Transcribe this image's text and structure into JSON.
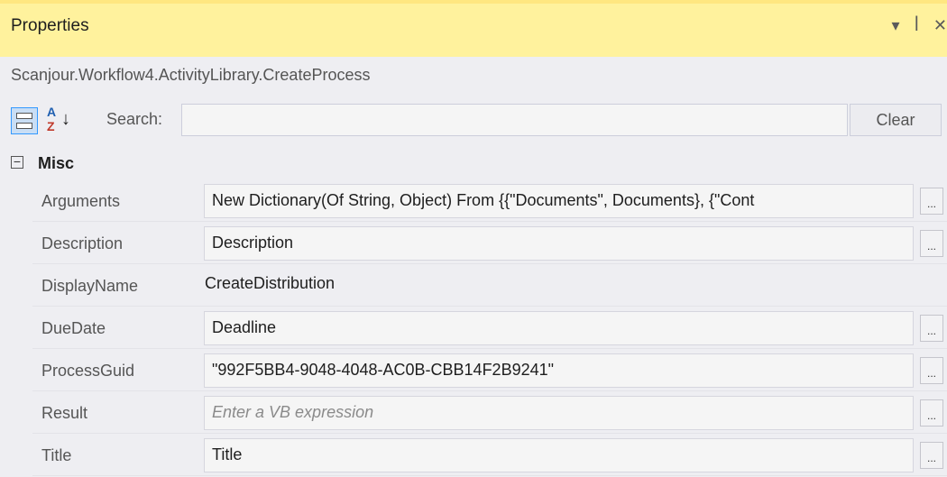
{
  "panel": {
    "title": "Properties",
    "dropdown_icon": "▾",
    "pin_icon": "ꟾ",
    "close_icon": "✕",
    "object_name": "Scanjour.Workflow4.ActivityLibrary.CreateProcess"
  },
  "toolbar": {
    "search_label": "Search:",
    "search_value": "",
    "clear_label": "Clear"
  },
  "category": {
    "toggle": "−",
    "label": "Misc"
  },
  "properties": [
    {
      "name": "Arguments",
      "value": "New Dictionary(Of String, Object) From {{\"Documents\", Documents}, {\"Cont",
      "kind": "box",
      "has_ellipsis": true
    },
    {
      "name": "Description",
      "value": "Description",
      "kind": "box",
      "has_ellipsis": true
    },
    {
      "name": "DisplayName",
      "value": "CreateDistribution",
      "kind": "plain",
      "has_ellipsis": false
    },
    {
      "name": "DueDate",
      "value": "Deadline",
      "kind": "box",
      "has_ellipsis": true
    },
    {
      "name": "ProcessGuid",
      "value": "\"992F5BB4-9048-4048-AC0B-CBB14F2B9241\"",
      "kind": "box",
      "has_ellipsis": true
    },
    {
      "name": "Result",
      "value": "Enter a VB expression",
      "kind": "placeholder",
      "has_ellipsis": true
    },
    {
      "name": "Title",
      "value": "Title",
      "kind": "box",
      "has_ellipsis": true
    }
  ],
  "ellipsis_label": "...",
  "colors": {
    "titlebar_bg": "#fff29d",
    "panel_bg": "#eeeef2",
    "selected_button": "#c9def5"
  }
}
